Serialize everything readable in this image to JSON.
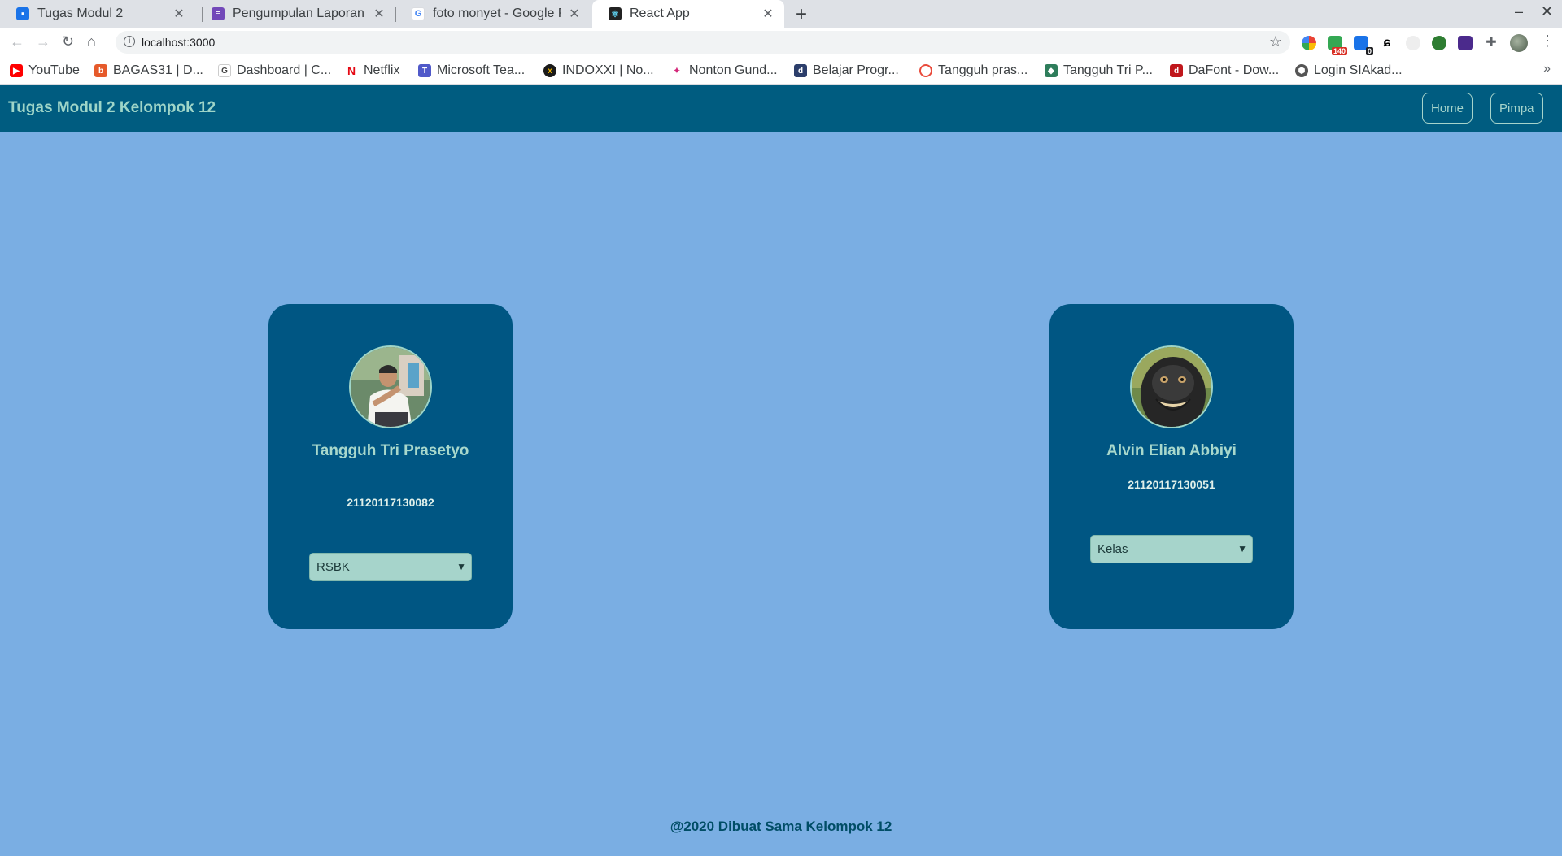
{
  "browser": {
    "tabs": [
      {
        "title": "Tugas Modul 2",
        "icon": "google-classroom-icon",
        "color": "#1a73e8"
      },
      {
        "title": "Pengumpulan Laporan Tu",
        "icon": "google-forms-icon",
        "color": "#7248b9"
      },
      {
        "title": "foto monyet - Google Pe",
        "icon": "google-icon",
        "color": "#4285f4"
      },
      {
        "title": "React App",
        "icon": "react-icon",
        "color": "#222222"
      }
    ],
    "url": "localhost:3000",
    "bookmarks": [
      {
        "label": "YouTube",
        "color": "#ff0000"
      },
      {
        "label": "BAGAS31 | D...",
        "color": "#e65a2b"
      },
      {
        "label": "Dashboard | C...",
        "color": "#444444"
      },
      {
        "label": "Netflix",
        "color": "#e50914"
      },
      {
        "label": "Microsoft Tea...",
        "color": "#5059c9"
      },
      {
        "label": "INDOXXI | No...",
        "color": "#1a1a1a"
      },
      {
        "label": "Nonton Gund...",
        "color": "#d4287a"
      },
      {
        "label": "Belajar Progr...",
        "color": "#2c3e6b"
      },
      {
        "label": "Tangguh pras...",
        "color": "#e94b3c"
      },
      {
        "label": "Tangguh Tri P...",
        "color": "#2e7d5b"
      },
      {
        "label": "DaFont - Dow...",
        "color": "#c0171c"
      },
      {
        "label": "Login SIAkad...",
        "color": "#555555"
      }
    ],
    "extension_badges": [
      "140",
      "0"
    ]
  },
  "app": {
    "brand": "Tugas Modul 2 Kelompok 12",
    "nav": {
      "home": "Home",
      "pimpa": "Pimpa"
    },
    "members": [
      {
        "name": "Tangguh Tri Prasetyo",
        "nim": "21120117130082",
        "select_value": "RSBK",
        "avatar": "person-photo"
      },
      {
        "name": "Alvin Elian Abbiyi",
        "nim": "21120117130051",
        "select_value": "Kelas",
        "avatar": "monkey-photo"
      }
    ],
    "footer": "@2020 Dibuat Sama Kelompok 12"
  },
  "colors": {
    "page_bg": "#7aaee3",
    "navbar_bg": "#005c80",
    "card_bg": "#005683",
    "accent": "#a6d4cb"
  }
}
